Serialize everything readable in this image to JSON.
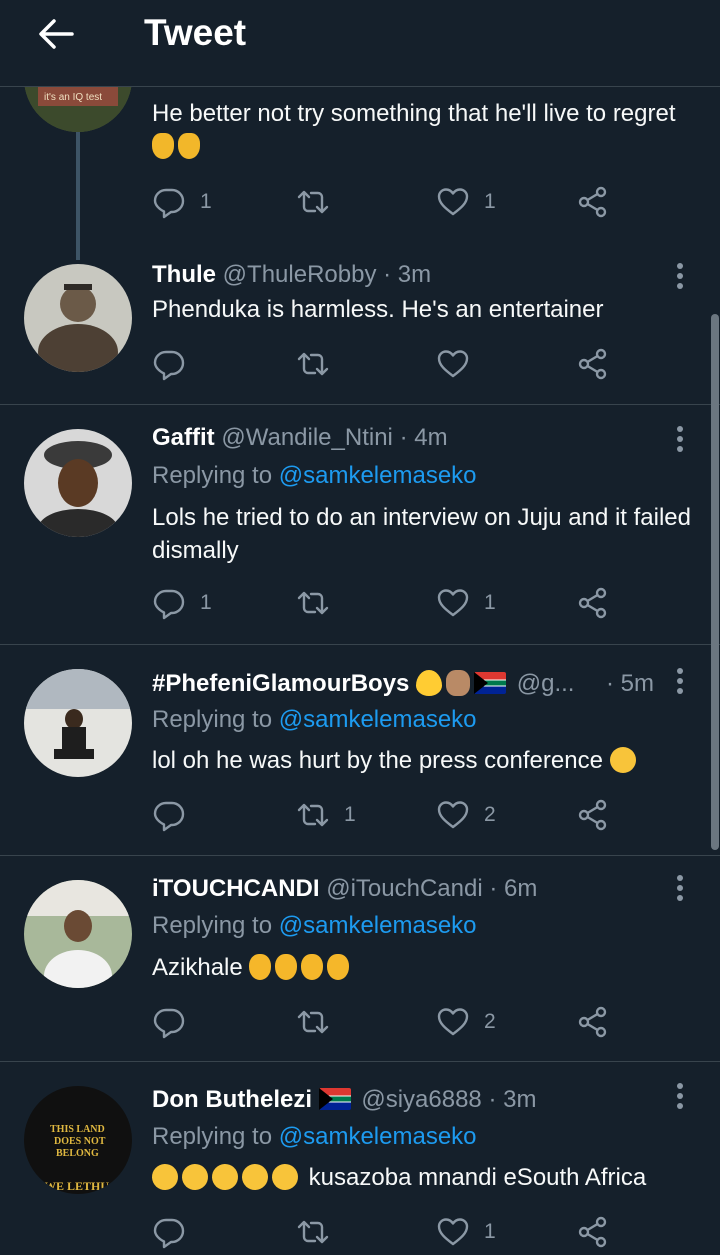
{
  "header": {
    "title": "Tweet"
  },
  "first_tweet": {
    "text": "He better not try something that he'll live to regret",
    "replies": "1",
    "retweets": "",
    "likes": "1"
  },
  "tweets": [
    {
      "name": "Thule",
      "handle": "@ThuleRobby",
      "time": "· 3m",
      "replying_label": "",
      "replying_handle": "",
      "text": "Phenduka is harmless. He's an entertainer",
      "replies": "",
      "retweets": "",
      "likes": ""
    },
    {
      "name": "Gaffit",
      "handle": "@Wandile_Ntini",
      "time": "· 4m",
      "replying_label": "Replying to",
      "replying_handle": "@samkelemaseko",
      "text": "Lols he tried to do an interview on Juju and it failed dismally",
      "replies": "1",
      "retweets": "",
      "likes": "1"
    },
    {
      "name": "#PhefeniGlamourBoys",
      "handle": "@g...",
      "time": "· 5m",
      "replying_label": "Replying to",
      "replying_handle": "@samkelemaseko",
      "text": "lol oh he was hurt by the press conference",
      "replies": "",
      "retweets": "1",
      "likes": "2"
    },
    {
      "name": "iTOUCHCANDI",
      "handle": "@iTouchCandi",
      "time": "· 6m",
      "replying_label": "Replying to",
      "replying_handle": "@samkelemaseko",
      "text": "Azikhale",
      "replies": "",
      "retweets": "",
      "likes": "2"
    },
    {
      "name": "Don Buthelezi",
      "handle": "@siya6888",
      "time": "· 3m",
      "replying_label": "Replying to",
      "replying_handle": "@samkelemaseko",
      "text": "kusazoba mnandi eSouth Africa",
      "replies": "",
      "retweets": "",
      "likes": "1"
    }
  ],
  "avatar_lettering": {
    "first": "it's an IQ test",
    "don": "THIS LAND DOES NOT BELONG TO ALL WHO LIVE IN IT WE LETHU"
  },
  "icons": [
    "back-arrow-icon",
    "reply-icon",
    "retweet-icon",
    "like-icon",
    "share-icon",
    "more-icon"
  ],
  "colors": {
    "background": "#15202b",
    "link": "#1d9bf0",
    "muted": "#8b98a5",
    "divider": "#38444d"
  }
}
